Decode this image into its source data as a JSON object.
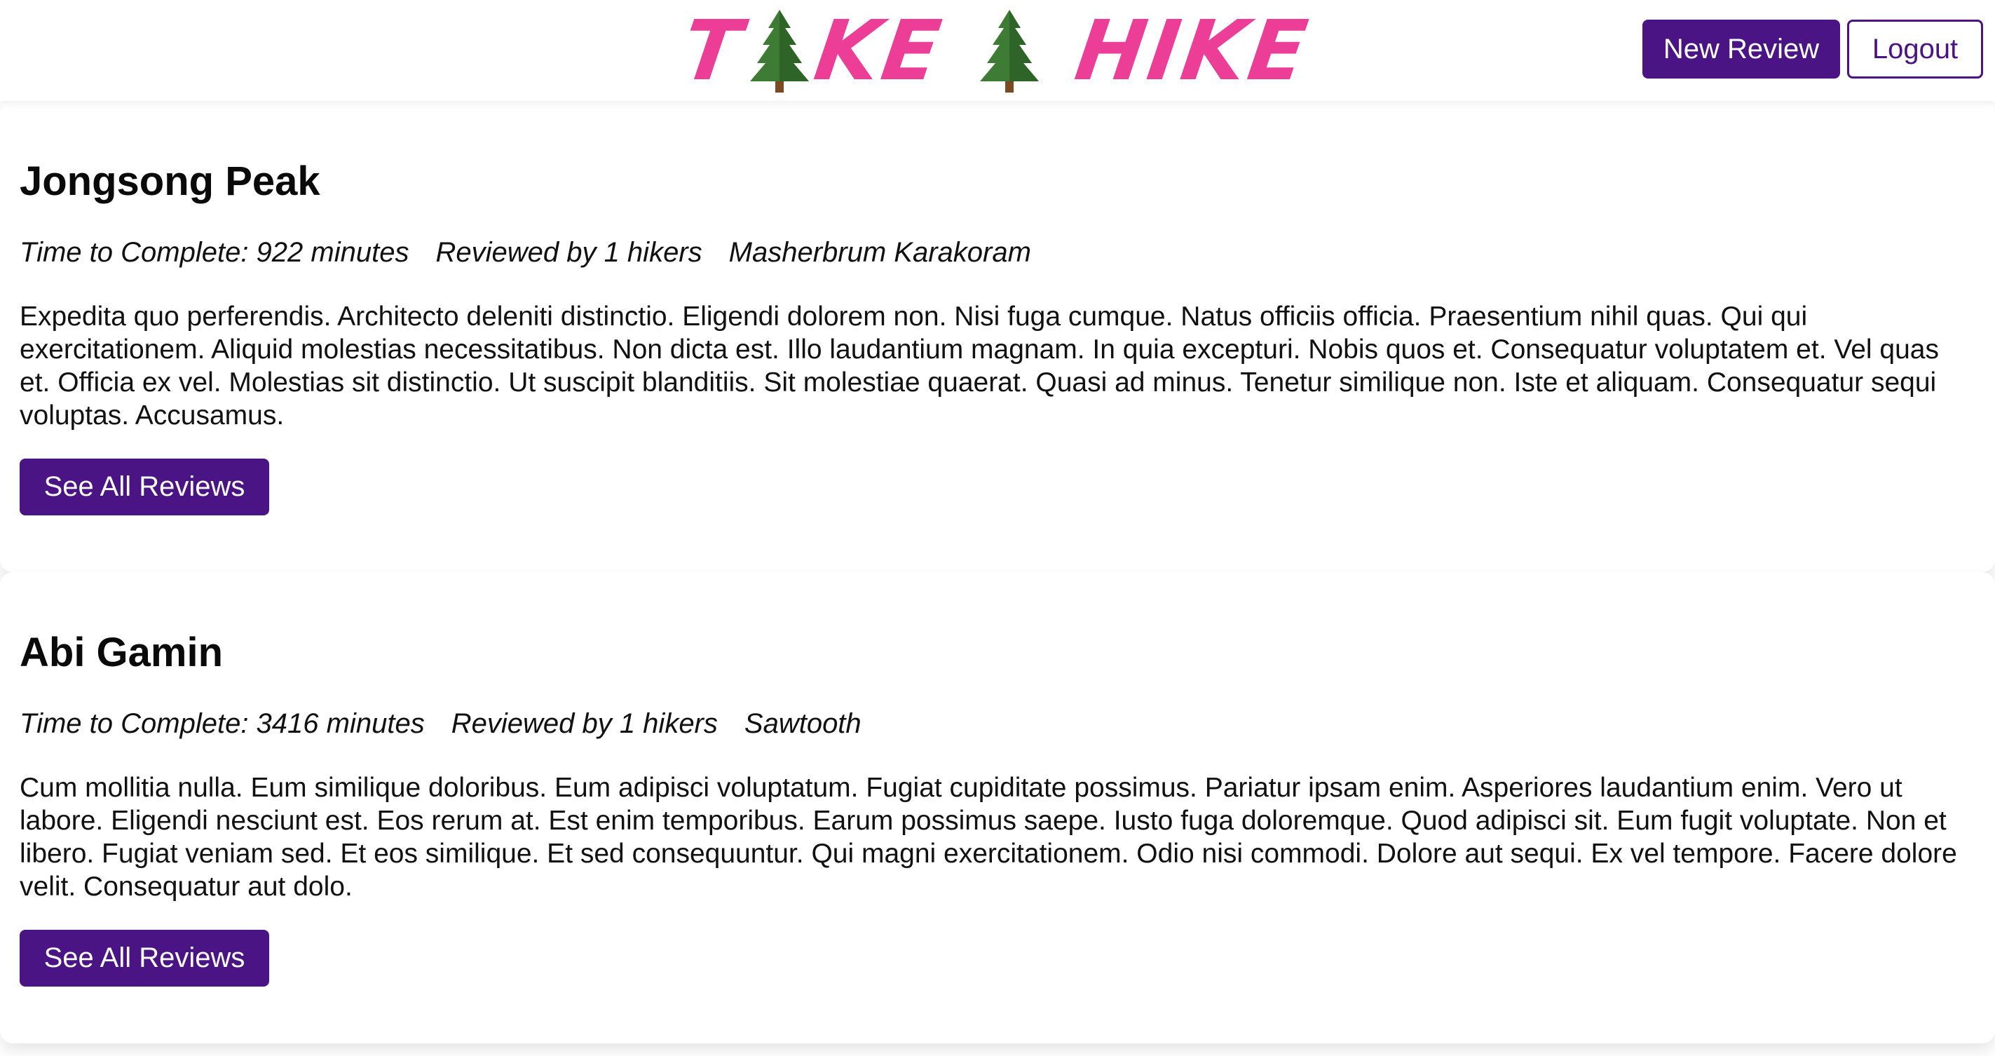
{
  "header": {
    "logo_part1": "T",
    "logo_part2": "KE",
    "logo_part3": "HIKE",
    "logo_icon": "evergreen-tree-icon",
    "new_review_label": "New Review",
    "logout_label": "Logout"
  },
  "colors": {
    "brand_pink": "#ec3d97",
    "accent_purple": "#4a1484"
  },
  "trails": [
    {
      "name": "Jongsong Peak",
      "time": "Time to Complete: 922 minutes",
      "reviewed": "Reviewed by 1 hikers",
      "range": "Masherbrum Karakoram",
      "description": "Expedita quo perferendis. Architecto deleniti distinctio. Eligendi dolorem non. Nisi fuga cumque. Natus officiis officia. Praesentium nihil quas. Qui qui exercitationem. Aliquid molestias necessitatibus. Non dicta est. Illo laudantium magnam. In quia excepturi. Nobis quos et. Consequatur voluptatem et. Vel quas et. Officia ex vel. Molestias sit distinctio. Ut suscipit blanditiis. Sit molestiae quaerat. Quasi ad minus. Tenetur similique non. Iste et aliquam. Consequatur sequi voluptas. Accusamus.",
      "button_label": "See All Reviews"
    },
    {
      "name": "Abi Gamin",
      "time": "Time to Complete: 3416 minutes",
      "reviewed": "Reviewed by 1 hikers",
      "range": "Sawtooth",
      "description": "Cum mollitia nulla. Eum similique doloribus. Eum adipisci voluptatum. Fugiat cupiditate possimus. Pariatur ipsam enim. Asperiores laudantium enim. Vero ut labore. Eligendi nesciunt est. Eos rerum at. Est enim temporibus. Earum possimus saepe. Iusto fuga doloremque. Quod adipisci sit. Eum fugit voluptate. Non et libero. Fugiat veniam sed. Et eos similique. Et sed consequuntur. Qui magni exercitationem. Odio nisi commodi. Dolore aut sequi. Ex vel tempore. Facere dolore velit. Consequatur aut dolo.",
      "button_label": "See All Reviews"
    }
  ]
}
